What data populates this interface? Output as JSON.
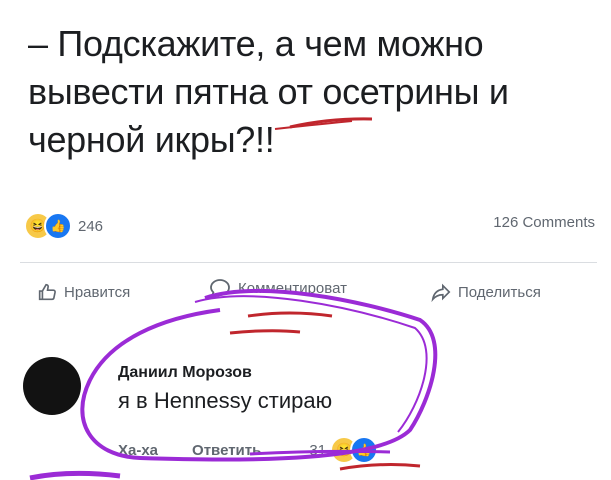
{
  "post": {
    "line1": "– Подскажите, а чем можно",
    "line2": "вывести пятна от осетрины и",
    "line3": "черной икры?!!"
  },
  "reactions": {
    "count": "246",
    "icons": [
      "haha-icon",
      "like-icon"
    ]
  },
  "comments_count": "126 Comments",
  "actions": {
    "like_label": "Нравится",
    "comment_label": "Комментироват",
    "share_label": "Поделиться"
  },
  "comment": {
    "author": "Даниил Морозов",
    "text": "я в Hennessy стираю",
    "haha_label": "Ха-ха",
    "reply_label": "Ответить",
    "reaction_count": "31"
  },
  "colors": {
    "scribble": "#9b2bd6",
    "underline": "#c0262d",
    "like": "#1877f2",
    "haha": "#f7c948"
  }
}
